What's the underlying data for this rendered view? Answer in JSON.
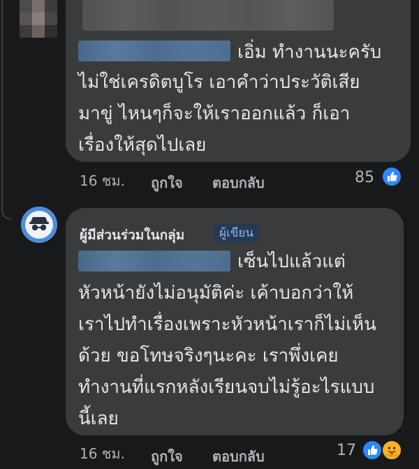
{
  "comment1": {
    "name_line_suffix": "เอิ่ม ทำงานนะครับ",
    "lines": [
      "ไม่ใช่เครดิตบูโร เอาคำว่าประวัติเสีย",
      "มาขู่ ไหนๆก็จะให้เราออกแล้ว ก็เอา",
      "เรื่องให้สุดไปเลย"
    ],
    "time": "16 ชม.",
    "like_label": "ถูกใจ",
    "reply_label": "ตอบกลับ",
    "reaction_count": "85"
  },
  "comment2": {
    "author": "ผู้มีส่วนร่วมในกลุ่ม",
    "badge": "ผู้เขียน",
    "name_line_suffix": "เซ็นไปแล้วแต่",
    "lines": [
      "หัวหน้ายังไม่อนุมัติค่ะ เค้าบอกว่าให้",
      "เราไปทำเรื่องเพราะหัวหน้าเราก็ไม่เห็น",
      "ด้วย ขอโทษจริงๆนะคะ เราพึ่งเคย",
      "ทำงานที่แรกหลังเรียนจบไม่รู้อะไรแบบ",
      "นี้เลย"
    ],
    "time": "16 ชม.",
    "like_label": "ถูกใจ",
    "reply_label": "ตอบกลับ",
    "reaction_count": "17"
  },
  "colors": {
    "background": "#18191a",
    "bubble": "#3a3b3c",
    "like_blue": "#2d88ff",
    "badge_text": "#8ab4f8"
  }
}
